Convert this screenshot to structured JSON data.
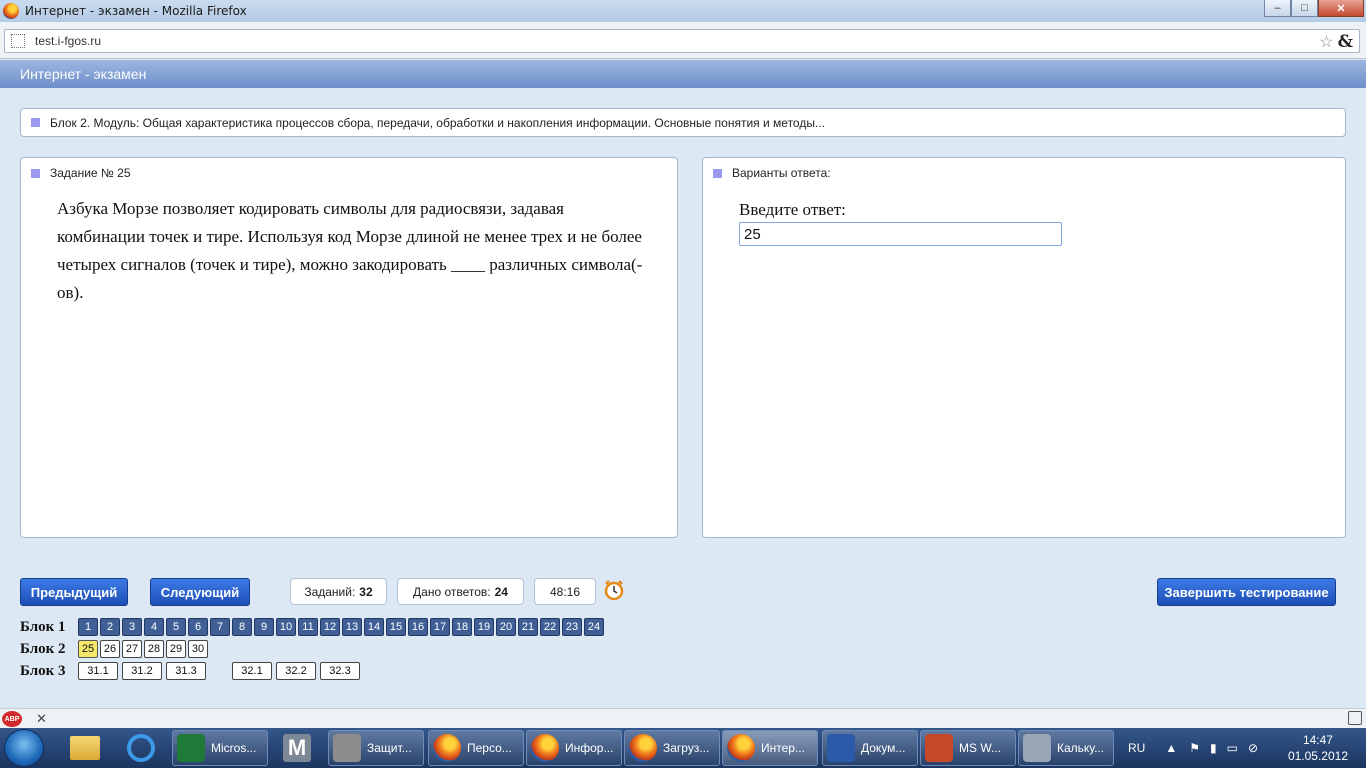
{
  "window": {
    "title": "Интернет - экзамен - Mozilla Firefox",
    "minimize": "–",
    "maximize": "□",
    "close": "✕"
  },
  "browser": {
    "url": "test.i-fgos.ru",
    "star": "☆",
    "amp": "&"
  },
  "app": {
    "header": "Интернет - экзамен",
    "block_title": "Блок 2. Модуль: Общая характеристика процессов сбора, передачи, обработки и накопления информации. Основные понятия и методы...",
    "task_title": "Задание № 25",
    "question": "Азбука Морзе позволяет кодировать символы для радиосвязи, задавая комбинации точек и тире. Используя код Морзе длиной не менее трех и не более четырех сигналов (точек и тире), можно закодировать ____ различных символа(-ов).",
    "answers_title": "Варианты ответа:",
    "answer_label": "Введите ответ:",
    "answer_value": "25"
  },
  "controls": {
    "prev": "Предыдущий",
    "next": "Следующий",
    "tasks_label": "Заданий:",
    "tasks_count": "32",
    "answered_label": "Дано ответов:",
    "answered_count": "24",
    "timer": "48:16",
    "finish": "Завершить тестирование"
  },
  "blocks": [
    {
      "label": "Блок 1",
      "items": [
        {
          "n": "1",
          "state": "done"
        },
        {
          "n": "2",
          "state": "done"
        },
        {
          "n": "3",
          "state": "done"
        },
        {
          "n": "4",
          "state": "done"
        },
        {
          "n": "5",
          "state": "done"
        },
        {
          "n": "6",
          "state": "done"
        },
        {
          "n": "7",
          "state": "done"
        },
        {
          "n": "8",
          "state": "done"
        },
        {
          "n": "9",
          "state": "done"
        },
        {
          "n": "10",
          "state": "done"
        },
        {
          "n": "11",
          "state": "done"
        },
        {
          "n": "12",
          "state": "done"
        },
        {
          "n": "13",
          "state": "done"
        },
        {
          "n": "14",
          "state": "done"
        },
        {
          "n": "15",
          "state": "done"
        },
        {
          "n": "16",
          "state": "done"
        },
        {
          "n": "17",
          "state": "done"
        },
        {
          "n": "18",
          "state": "done"
        },
        {
          "n": "19",
          "state": "done"
        },
        {
          "n": "20",
          "state": "done"
        },
        {
          "n": "21",
          "state": "done"
        },
        {
          "n": "22",
          "state": "done"
        },
        {
          "n": "23",
          "state": "done"
        },
        {
          "n": "24",
          "state": "done"
        }
      ]
    },
    {
      "label": "Блок 2",
      "items": [
        {
          "n": "25",
          "state": "current"
        },
        {
          "n": "26",
          "state": "open"
        },
        {
          "n": "27",
          "state": "open"
        },
        {
          "n": "28",
          "state": "open"
        },
        {
          "n": "29",
          "state": "open"
        },
        {
          "n": "30",
          "state": "open"
        }
      ]
    },
    {
      "label": "Блок 3",
      "items": [
        {
          "n": "31.1",
          "state": "open"
        },
        {
          "n": "31.2",
          "state": "open"
        },
        {
          "n": "31.3",
          "state": "open"
        },
        {
          "n": "32.1",
          "state": "open"
        },
        {
          "n": "32.2",
          "state": "open"
        },
        {
          "n": "32.3",
          "state": "open"
        }
      ]
    }
  ],
  "addon_bar": {
    "abp": "ABP",
    "close": "✕"
  },
  "taskbar": {
    "items": [
      {
        "label": "Micros...",
        "icon": "excel-icon",
        "color": "#1f7a3a"
      },
      {
        "label": "Защит...",
        "icon": "firewall-icon",
        "color": "#8c8c8c"
      },
      {
        "label": "Персо...",
        "icon": "firefox-icon",
        "color": ""
      },
      {
        "label": "Инфор...",
        "icon": "firefox-icon",
        "color": ""
      },
      {
        "label": "Загруз...",
        "icon": "firefox-icon",
        "color": ""
      },
      {
        "label": "Интер...",
        "icon": "firefox-icon",
        "color": "",
        "active": true
      },
      {
        "label": "Докум...",
        "icon": "word-icon",
        "color": "#2a5aa8"
      },
      {
        "label": "MS W...",
        "icon": "powerpoint-icon",
        "color": "#c8482a"
      },
      {
        "label": "Кальку...",
        "icon": "calculator-icon",
        "color": "#9aa6b5"
      }
    ],
    "lang": "RU",
    "time": "14:47",
    "date": "01.05.2012"
  }
}
